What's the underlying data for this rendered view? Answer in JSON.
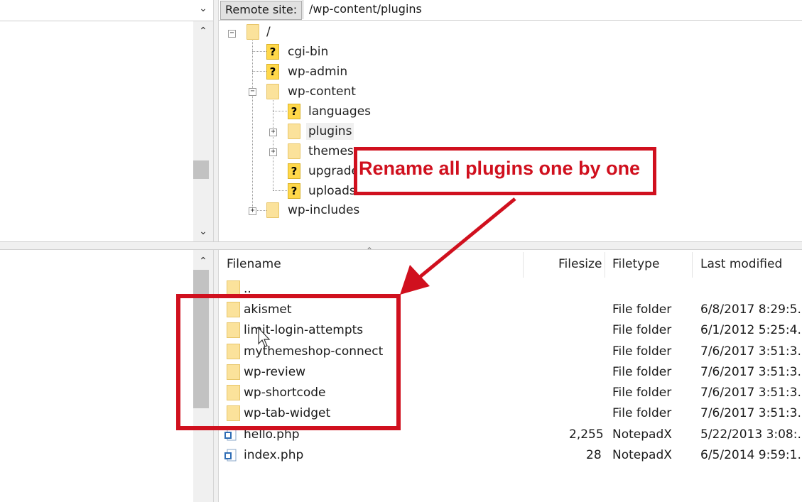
{
  "remote": {
    "label": "Remote site:",
    "path": "/wp-content/plugins"
  },
  "tree": {
    "root": "/",
    "items": [
      "cgi-bin",
      "wp-admin",
      "wp-content",
      "languages",
      "plugins",
      "themes",
      "upgrade",
      "uploads",
      "wp-includes"
    ]
  },
  "filelist": {
    "headers": {
      "name": "Filename",
      "size": "Filesize",
      "type": "Filetype",
      "modified": "Last modified"
    },
    "rows": [
      {
        "name": "..",
        "size": "",
        "type": "",
        "modified": ""
      },
      {
        "name": "akismet",
        "size": "",
        "type": "File folder",
        "modified": "6/8/2017 8:29:5..."
      },
      {
        "name": "limit-login-attempts",
        "size": "",
        "type": "File folder",
        "modified": "6/1/2012 5:25:4..."
      },
      {
        "name": "mythemeshop-connect",
        "size": "",
        "type": "File folder",
        "modified": "7/6/2017 3:51:3..."
      },
      {
        "name": "wp-review",
        "size": "",
        "type": "File folder",
        "modified": "7/6/2017 3:51:3..."
      },
      {
        "name": "wp-shortcode",
        "size": "",
        "type": "File folder",
        "modified": "7/6/2017 3:51:3..."
      },
      {
        "name": "wp-tab-widget",
        "size": "",
        "type": "File folder",
        "modified": "7/6/2017 3:51:3..."
      },
      {
        "name": "hello.php",
        "size": "2,255",
        "type": "NotepadX",
        "modified": "5/22/2013 3:08:..."
      },
      {
        "name": "index.php",
        "size": "28",
        "type": "NotepadX",
        "modified": "6/5/2014 9:59:1..."
      }
    ]
  },
  "annotation": {
    "text": "Rename all plugins one by one",
    "color": "#d0101e"
  },
  "icons": {
    "folder": "folder-icon",
    "unknown_folder": "question-folder-icon",
    "php": "php-file-icon",
    "chevron_up": "chevron-up-icon",
    "chevron_down": "chevron-down-icon"
  }
}
